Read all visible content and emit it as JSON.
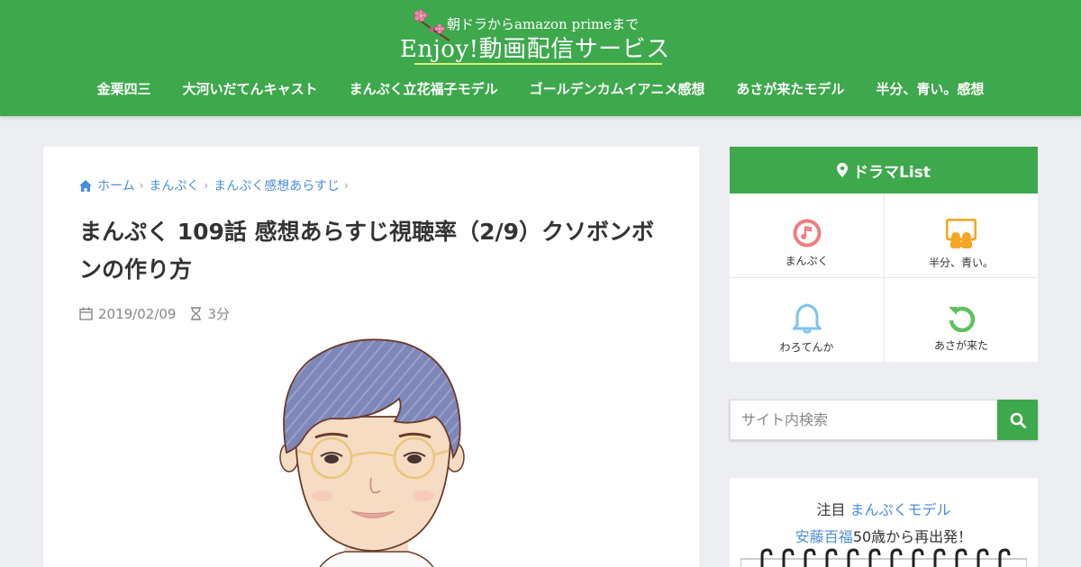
{
  "site": {
    "logo_sub": "朝ドラからamazon primeまで",
    "logo_main": "Enjoy!動画配信サービス"
  },
  "nav": [
    {
      "label": "金栗四三"
    },
    {
      "label": "大河いだてんキャスト"
    },
    {
      "label": "まんぷく立花福子モデル"
    },
    {
      "label": "ゴールデンカムイアニメ感想"
    },
    {
      "label": "あさが来たモデル"
    },
    {
      "label": "半分、青い。感想"
    }
  ],
  "breadcrumb": [
    {
      "label": "ホーム"
    },
    {
      "label": "まんぷく"
    },
    {
      "label": "まんぷく感想あらすじ"
    }
  ],
  "article": {
    "title": "まんぷく 109話 感想あらすじ視聴率（2/9）クソボンボンの作り方",
    "date": "2019/02/09",
    "read_time": "3分"
  },
  "sidebar": {
    "heading": "ドラマList",
    "items": [
      {
        "label": "まんぷく",
        "icon": "music-note-icon",
        "color": "#f07d7d"
      },
      {
        "label": "半分、青い。",
        "icon": "people-board-icon",
        "color": "#f5a623"
      },
      {
        "label": "わろてんか",
        "icon": "bell-icon",
        "color": "#7cc4f0"
      },
      {
        "label": "あさが来た",
        "icon": "refresh-icon",
        "color": "#5cc45c"
      }
    ],
    "search_placeholder": "サイト内検索",
    "promo": {
      "prefix": "注目",
      "link1": "まんぷくモデル",
      "link2": "安藤百福",
      "suffix": "50歳から再出発！"
    }
  },
  "colors": {
    "brand_green": "#3ea84c",
    "link_blue": "#4a8fd8",
    "background": "#eceef2"
  }
}
